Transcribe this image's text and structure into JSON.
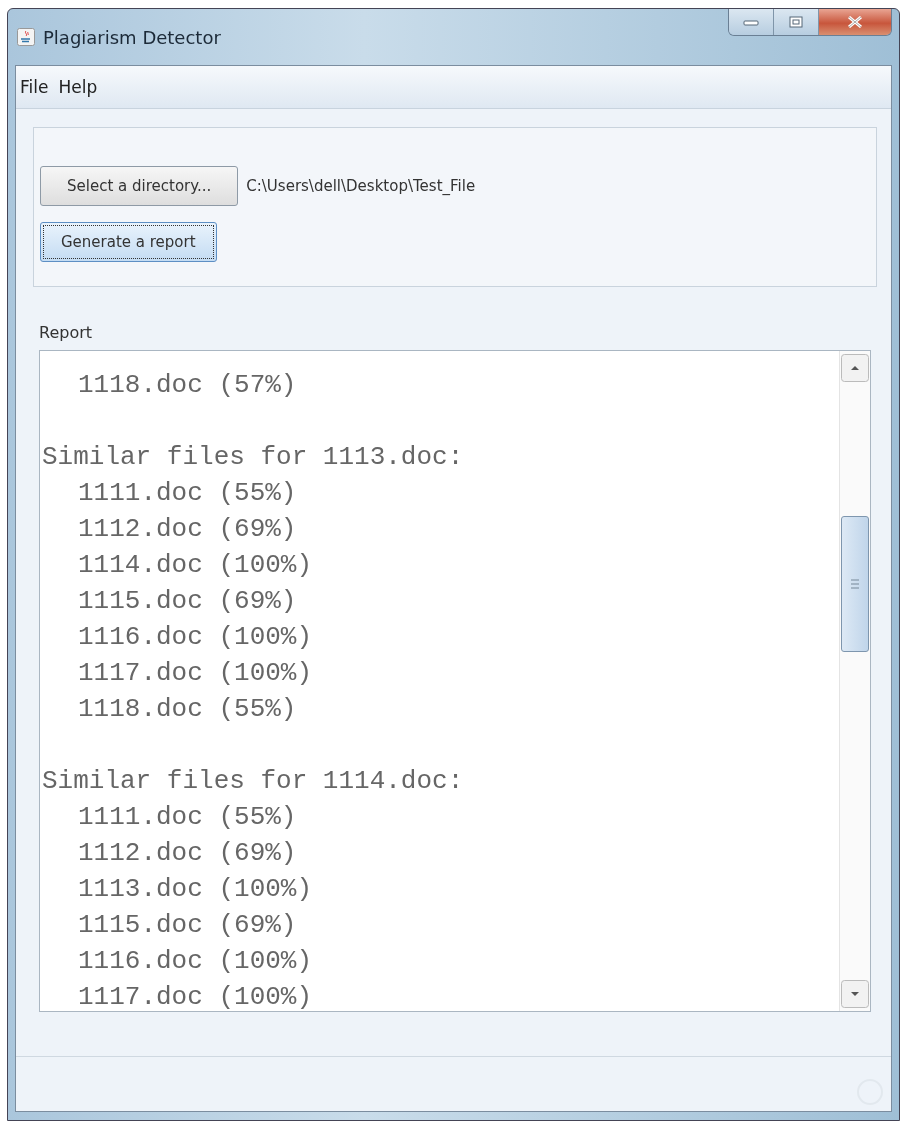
{
  "window": {
    "title": "Plagiarism Detector"
  },
  "menu": [
    "File",
    "Help"
  ],
  "controls": {
    "select_button": "Select a directory...",
    "path": "C:\\Users\\dell\\Desktop\\Test_File",
    "generate_button": "Generate a report",
    "generate_focused": true
  },
  "report": {
    "label": "Report",
    "sections": [
      {
        "items": [
          "1118.doc (57%)"
        ]
      },
      {
        "heading": "Similar files for 1113.doc:",
        "items": [
          "1111.doc (55%)",
          "1112.doc (69%)",
          "1114.doc (100%)",
          "1115.doc (69%)",
          "1116.doc (100%)",
          "1117.doc (100%)",
          "1118.doc (55%)"
        ]
      },
      {
        "heading": "Similar files for 1114.doc:",
        "items": [
          "1111.doc (55%)",
          "1112.doc (69%)",
          "1113.doc (100%)",
          "1115.doc (69%)",
          "1116.doc (100%)",
          "1117.doc (100%)"
        ]
      }
    ]
  }
}
